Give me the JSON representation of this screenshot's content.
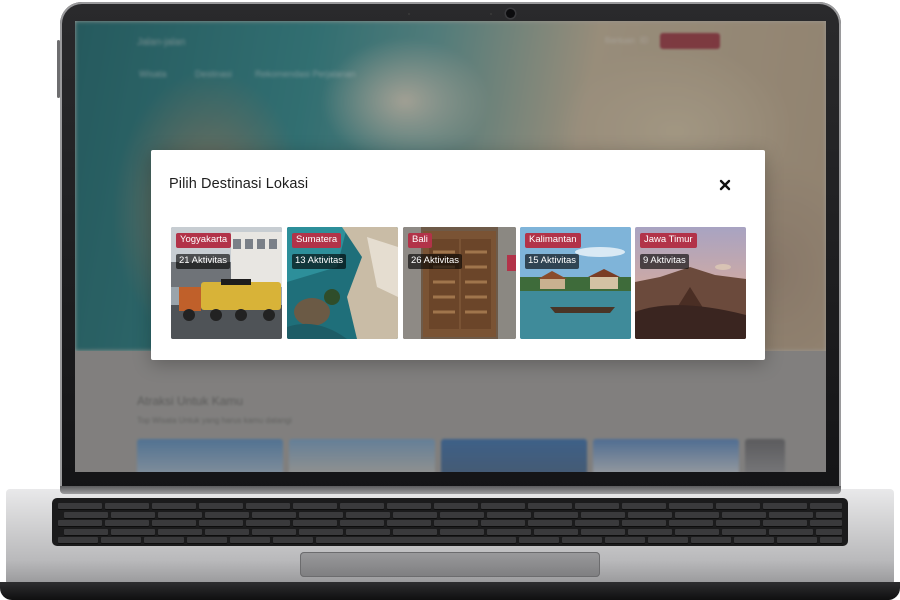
{
  "background_page": {
    "brand": "Jalan-jalan",
    "nav": [
      "Wisata",
      "Destinasi",
      "Rekomendasi Perjalanan"
    ],
    "top_menu": [
      "Bantuan",
      "ID"
    ],
    "login_label": "Login",
    "section_heading": "Atraksi Untuk Kamu",
    "section_subtitle": "Top Wisata Untuk yang harus kamu datangi"
  },
  "modal": {
    "title": "Pilih Destinasi Lokasi",
    "close_icon": "close-icon",
    "destinations": [
      {
        "name": "Yogyakarta",
        "activities": "21 Aktivitas"
      },
      {
        "name": "Sumatera",
        "activities": "13 Aktivitas"
      },
      {
        "name": "Bali",
        "activities": "26 Aktivitas"
      },
      {
        "name": "Kalimantan",
        "activities": "15 Aktivitas"
      },
      {
        "name": "Jawa Timur",
        "activities": "9 Aktivitas"
      }
    ]
  },
  "colors": {
    "accent": "#b23349",
    "modal_bg": "#ffffff",
    "overlay": "rgba(60,60,60,0.35)"
  }
}
